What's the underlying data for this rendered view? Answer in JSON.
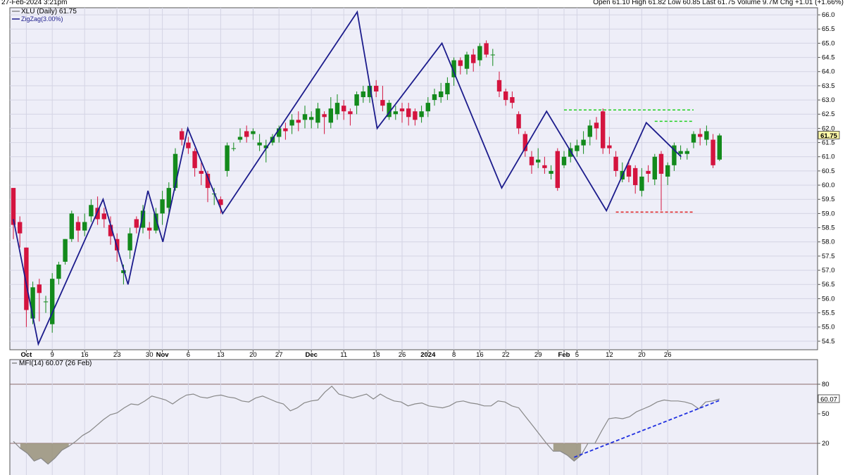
{
  "header": {
    "timestamp": "27-Feb-2024 3:21pm",
    "quote": "Open 61.10  High 61.82  Low 60.85  Last 61.75  Volume 9.7M  Chg +1.01 (+1.66%)"
  },
  "colors": {
    "up": "#138a1c",
    "down": "#d4143f",
    "zigzag": "#1c1c8c",
    "panel_bg": "#eeeef8",
    "mfi_line": "#888888",
    "mfi_fill": "#9c9680",
    "support": "#e02020",
    "resistance": "#20d020",
    "divergence": "#2030e0",
    "price_label": "#fff8a8"
  },
  "chart_data": [
    {
      "type": "candlestick",
      "legend": [
        "XLU (Daily) 61.75",
        "ZigZag(3.00%)"
      ],
      "series": [
        {
          "name": "XLU (Daily) 61.75"
        },
        {
          "name": "ZigZag(3.00%)"
        }
      ],
      "ylim": [
        54.2,
        66.25
      ],
      "y_ticks": [
        "54.5",
        "55.0",
        "55.5",
        "56.0",
        "56.5",
        "57.0",
        "57.5",
        "58.0",
        "58.5",
        "59.0",
        "59.5",
        "60.0",
        "60.5",
        "61.0",
        "61.5",
        "62.0",
        "62.5",
        "63.0",
        "63.5",
        "64.0",
        "64.5",
        "65.0",
        "65.5",
        "66.0"
      ],
      "x_ticks": [
        {
          "label": "Oct",
          "i": 2,
          "bold": true
        },
        {
          "label": "9",
          "i": 6
        },
        {
          "label": "16",
          "i": 11
        },
        {
          "label": "23",
          "i": 16
        },
        {
          "label": "30",
          "i": 21
        },
        {
          "label": "Nov",
          "i": 23,
          "bold": true
        },
        {
          "label": "6",
          "i": 27
        },
        {
          "label": "13",
          "i": 32
        },
        {
          "label": "20",
          "i": 37
        },
        {
          "label": "27",
          "i": 41
        },
        {
          "label": "Dec",
          "i": 46,
          "bold": true
        },
        {
          "label": "11",
          "i": 51
        },
        {
          "label": "18",
          "i": 56
        },
        {
          "label": "26",
          "i": 60
        },
        {
          "label": "2024",
          "i": 64,
          "bold": true
        },
        {
          "label": "8",
          "i": 68
        },
        {
          "label": "16",
          "i": 72
        },
        {
          "label": "22",
          "i": 76
        },
        {
          "label": "29",
          "i": 81
        },
        {
          "label": "Feb",
          "i": 85,
          "bold": true
        },
        {
          "label": "5",
          "i": 87
        },
        {
          "label": "12",
          "i": 92
        },
        {
          "label": "20",
          "i": 97
        },
        {
          "label": "26",
          "i": 101
        }
      ],
      "last_price_label": "61.75",
      "candles": [
        [
          59.9,
          58.6,
          59.9,
          58.1
        ],
        [
          58.7,
          58.3,
          58.9,
          57.8
        ],
        [
          57.8,
          55.6,
          57.8,
          55.0
        ],
        [
          55.3,
          56.4,
          56.6,
          55.1
        ],
        [
          56.5,
          56.2,
          56.7,
          55.2
        ],
        [
          55.9,
          55.9,
          56.1,
          55.5
        ],
        [
          55.1,
          56.7,
          56.9,
          54.8
        ],
        [
          56.7,
          57.2,
          57.3,
          56.5
        ],
        [
          57.3,
          58.1,
          58.1,
          57.2
        ],
        [
          58.1,
          59.0,
          59.1,
          58.0
        ],
        [
          58.7,
          58.4,
          58.9,
          58.0
        ],
        [
          58.4,
          58.7,
          59.0,
          58.2
        ],
        [
          58.9,
          59.3,
          59.5,
          58.7
        ],
        [
          59.2,
          58.8,
          59.6,
          58.6
        ],
        [
          59.0,
          58.8,
          59.2,
          58.5
        ],
        [
          58.6,
          58.2,
          58.9,
          57.9
        ],
        [
          58.1,
          57.7,
          58.3,
          57.3
        ],
        [
          56.9,
          57.0,
          57.2,
          56.5
        ],
        [
          57.7,
          58.3,
          58.5,
          57.4
        ],
        [
          58.8,
          58.5,
          58.9,
          58.3
        ],
        [
          58.5,
          59.1,
          59.3,
          58.3
        ],
        [
          58.5,
          58.4,
          58.7,
          58.1
        ],
        [
          58.4,
          59.0,
          59.2,
          58.3
        ],
        [
          59.0,
          59.5,
          59.8,
          58.6
        ],
        [
          59.2,
          59.9,
          60.1,
          59.0
        ],
        [
          59.9,
          61.1,
          61.3,
          59.8
        ],
        [
          61.9,
          61.6,
          62.0,
          61.4
        ],
        [
          61.5,
          61.3,
          61.7,
          61.1
        ],
        [
          61.2,
          60.6,
          61.3,
          60.3
        ],
        [
          60.5,
          60.4,
          60.8,
          60.0
        ],
        [
          60.4,
          59.9,
          60.5,
          59.4
        ],
        [
          59.7,
          59.7,
          59.9,
          59.3
        ],
        [
          59.5,
          59.3,
          59.6,
          59.0
        ],
        [
          60.5,
          61.4,
          61.5,
          60.3
        ],
        [
          61.3,
          61.3,
          61.5,
          61.2
        ],
        [
          61.6,
          61.7,
          62.0,
          61.5
        ],
        [
          61.9,
          61.7,
          62.1,
          61.5
        ],
        [
          61.8,
          61.9,
          62.0,
          61.6
        ],
        [
          61.4,
          61.5,
          61.8,
          61.2
        ],
        [
          61.3,
          61.4,
          61.6,
          60.8
        ],
        [
          61.5,
          61.7,
          61.8,
          61.4
        ],
        [
          61.7,
          62.0,
          62.1,
          61.5
        ],
        [
          62.0,
          61.9,
          62.2,
          61.6
        ],
        [
          62.1,
          62.3,
          62.5,
          61.8
        ],
        [
          62.3,
          62.2,
          62.6,
          61.9
        ],
        [
          62.3,
          62.5,
          62.8,
          62.0
        ],
        [
          62.3,
          62.4,
          62.6,
          62.0
        ],
        [
          62.2,
          62.7,
          62.9,
          62.0
        ],
        [
          62.5,
          62.4,
          62.6,
          61.8
        ],
        [
          62.2,
          62.7,
          63.1,
          62.0
        ],
        [
          62.5,
          62.9,
          63.2,
          62.3
        ],
        [
          62.8,
          62.6,
          63.0,
          62.3
        ],
        [
          62.6,
          62.5,
          62.7,
          62.1
        ],
        [
          62.8,
          63.2,
          63.3,
          62.5
        ],
        [
          63.1,
          63.3,
          63.5,
          62.9
        ],
        [
          63.1,
          63.5,
          63.6,
          62.9
        ],
        [
          63.5,
          63.3,
          63.7,
          63.1
        ],
        [
          63.0,
          62.8,
          63.5,
          62.6
        ],
        [
          62.4,
          62.9,
          63.0,
          62.3
        ],
        [
          62.5,
          62.6,
          62.8,
          62.3
        ],
        [
          62.7,
          62.6,
          62.9,
          62.2
        ],
        [
          62.7,
          62.4,
          62.9,
          62.1
        ],
        [
          62.6,
          62.3,
          62.7,
          62.1
        ],
        [
          62.4,
          62.6,
          62.8,
          62.2
        ],
        [
          62.6,
          62.9,
          63.1,
          62.4
        ],
        [
          63.0,
          63.2,
          63.4,
          62.8
        ],
        [
          63.1,
          63.3,
          63.6,
          62.9
        ],
        [
          63.2,
          63.6,
          63.8,
          63.0
        ],
        [
          63.8,
          64.4,
          64.5,
          63.5
        ],
        [
          64.4,
          64.2,
          64.5,
          63.9
        ],
        [
          64.1,
          64.6,
          64.7,
          63.9
        ],
        [
          64.6,
          64.3,
          64.8,
          64.0
        ],
        [
          64.4,
          64.9,
          65.0,
          64.2
        ],
        [
          65.0,
          64.6,
          65.1,
          64.5
        ],
        [
          64.6,
          64.6,
          64.8,
          64.2
        ],
        [
          63.7,
          63.3,
          64.0,
          63.1
        ],
        [
          63.3,
          63.0,
          63.4,
          62.8
        ],
        [
          63.1,
          62.9,
          63.3,
          62.7
        ],
        [
          62.5,
          62.0,
          62.6,
          61.8
        ],
        [
          61.8,
          61.2,
          61.9,
          61.0
        ],
        [
          61.0,
          60.7,
          61.2,
          60.4
        ],
        [
          60.8,
          60.9,
          61.3,
          60.6
        ],
        [
          60.7,
          60.6,
          61.0,
          60.4
        ],
        [
          60.4,
          60.5,
          60.7,
          60.2
        ],
        [
          61.2,
          59.9,
          61.3,
          59.8
        ],
        [
          60.7,
          61.0,
          61.2,
          60.6
        ],
        [
          61.0,
          61.3,
          61.5,
          60.8
        ],
        [
          61.2,
          61.4,
          61.6,
          61.0
        ],
        [
          61.4,
          61.6,
          61.9,
          61.1
        ],
        [
          61.7,
          62.1,
          62.3,
          61.4
        ],
        [
          62.2,
          62.0,
          62.4,
          61.6
        ],
        [
          62.6,
          61.3,
          62.7,
          61.1
        ],
        [
          61.4,
          61.3,
          61.7,
          61.1
        ],
        [
          61.0,
          60.5,
          61.2,
          60.3
        ],
        [
          60.2,
          60.5,
          60.8,
          60.1
        ],
        [
          60.7,
          60.3,
          60.9,
          60.1
        ],
        [
          60.6,
          60.0,
          60.7,
          59.7
        ],
        [
          59.8,
          60.3,
          60.6,
          59.6
        ],
        [
          60.5,
          60.4,
          60.7,
          60.1
        ],
        [
          60.2,
          61.0,
          61.1,
          60.0
        ],
        [
          61.1,
          60.4,
          61.2,
          59.1
        ],
        [
          60.3,
          60.7,
          60.8,
          60.0
        ],
        [
          60.7,
          61.4,
          61.5,
          60.5
        ],
        [
          61.1,
          61.2,
          61.4,
          60.9
        ],
        [
          61.1,
          61.2,
          61.3,
          60.9
        ],
        [
          61.5,
          61.8,
          61.9,
          61.3
        ],
        [
          61.8,
          61.7,
          62.0,
          61.4
        ],
        [
          61.6,
          61.9,
          62.1,
          61.4
        ],
        [
          61.6,
          60.7,
          61.8,
          60.6
        ],
        [
          60.9,
          61.75,
          61.82,
          60.85
        ]
      ],
      "zigzag": [
        [
          0,
          58.8
        ],
        [
          5,
          54.4
        ],
        [
          18,
          59.5
        ],
        [
          23,
          56.5
        ],
        [
          27,
          59.8
        ],
        [
          30,
          58.0
        ],
        [
          35,
          62.0
        ],
        [
          42,
          59.0
        ],
        [
          69,
          66.1
        ],
        [
          73,
          62.0
        ],
        [
          86,
          65.0
        ],
        [
          98,
          59.9
        ],
        [
          107,
          62.6
        ],
        [
          119,
          59.1
        ],
        [
          127,
          62.2
        ],
        [
          134,
          61.0
        ]
      ],
      "support_line": {
        "y": 59.05,
        "from_i": 93,
        "to_i": 105
      },
      "resistance_lines": [
        {
          "y": 62.65,
          "from_i": 85,
          "to_i": 105
        },
        {
          "y": 62.25,
          "from_i": 99,
          "to_i": 105
        }
      ]
    },
    {
      "type": "line",
      "legend": "MFI(14) 60.07 (26 Feb)",
      "series": [
        {
          "name": "MFI(14) 60.07 (26 Feb)"
        }
      ],
      "ylim": [
        0,
        100
      ],
      "y_ticks": [
        "20",
        "50",
        "80"
      ],
      "levels": [
        20,
        80
      ],
      "last_value_label": "60.07",
      "values": [
        22,
        15,
        10,
        2,
        5,
        -1,
        5,
        13,
        17,
        22,
        28,
        32,
        38,
        44,
        49,
        51,
        56,
        60,
        59,
        63,
        68,
        66,
        64,
        60,
        65,
        69,
        70,
        67,
        66,
        68,
        69,
        67,
        66,
        63,
        62,
        66,
        68,
        65,
        62,
        60,
        53,
        56,
        61,
        63,
        64,
        72,
        78,
        70,
        68,
        66,
        68,
        70,
        65,
        70,
        66,
        63,
        62,
        58,
        60,
        61,
        58,
        57,
        56,
        58,
        62,
        63,
        61,
        60,
        58,
        58,
        63,
        62,
        58,
        56,
        47,
        38,
        29,
        20,
        12,
        12,
        8,
        2,
        8,
        20,
        20,
        33,
        45,
        46,
        45,
        47,
        52,
        55,
        58,
        62,
        64,
        63,
        63,
        62,
        60,
        55,
        62,
        63,
        65
      ]
    }
  ]
}
